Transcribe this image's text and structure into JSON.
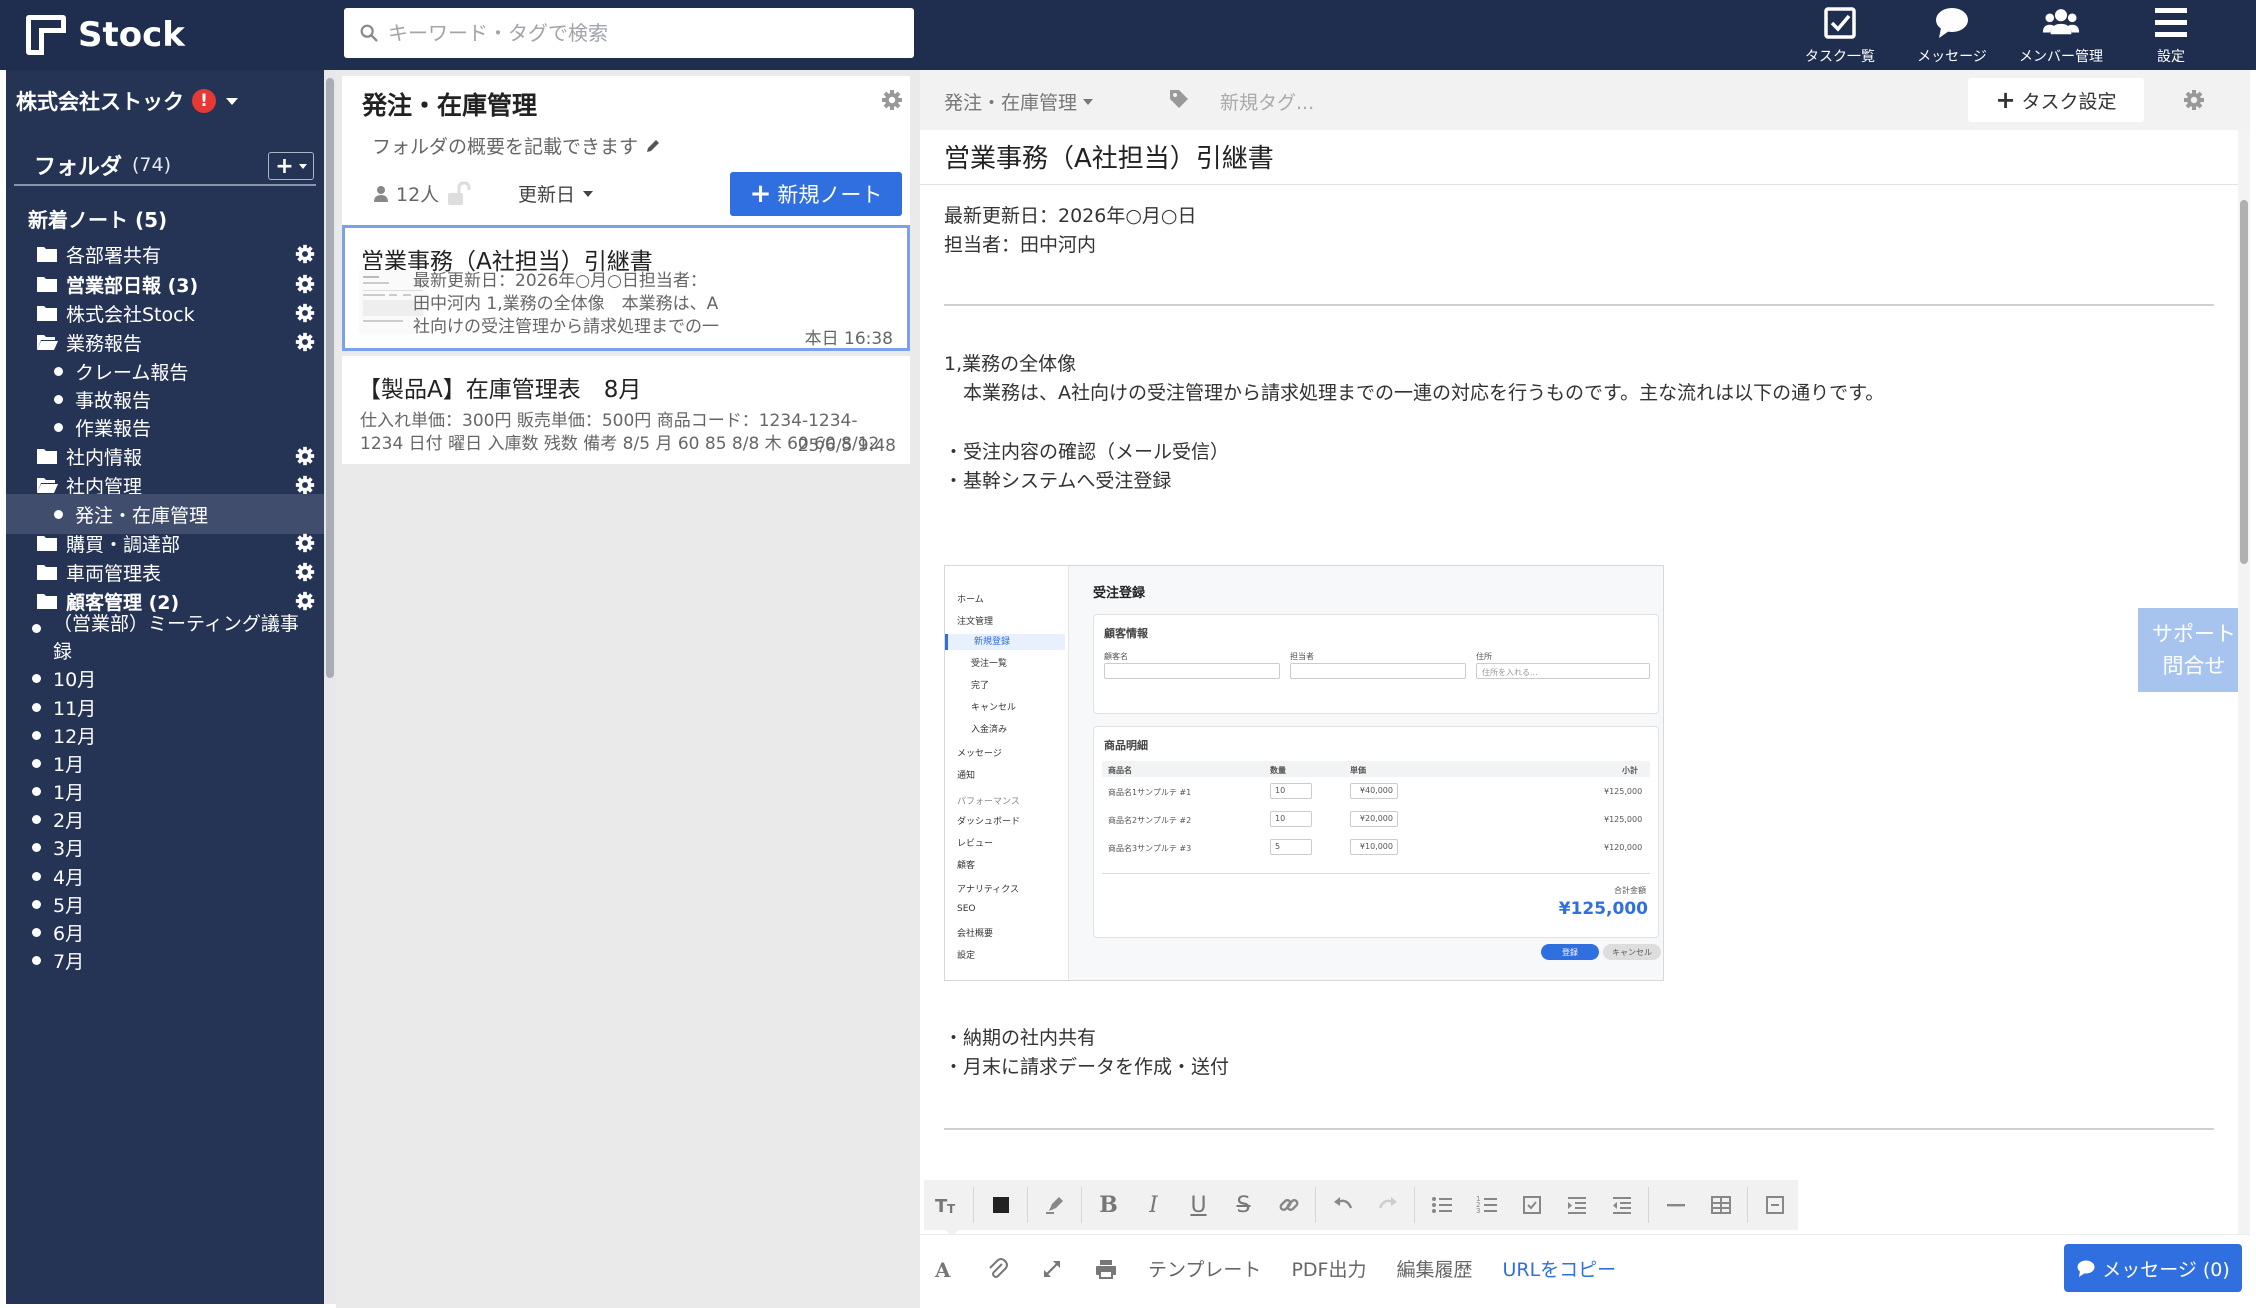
{
  "app": {
    "name": "Stock"
  },
  "search": {
    "placeholder": "キーワード・タグで検索"
  },
  "nav": [
    {
      "label": "タスク一覧",
      "icon": "task-checkbox-icon"
    },
    {
      "label": "メッセージ",
      "icon": "message-bubble-icon"
    },
    {
      "label": "メンバー管理",
      "icon": "members-icon"
    },
    {
      "label": "設定",
      "icon": "menu-icon"
    }
  ],
  "sidebar": {
    "company": "株式会社ストック",
    "alert": "!",
    "folders_label": "フォルダ",
    "folders_count": "(74)",
    "add_label": "+",
    "new_notes": "新着ノート (5)",
    "items": [
      {
        "label": "各部署共有",
        "kind": "folder",
        "bold": false,
        "gear": true
      },
      {
        "label": "営業部日報 (3)",
        "kind": "folder",
        "bold": true,
        "gear": true
      },
      {
        "label": "株式会社Stock",
        "kind": "folder",
        "bold": false,
        "gear": true
      },
      {
        "label": "業務報告",
        "kind": "folder-open",
        "bold": false,
        "gear": true
      },
      {
        "label": "クレーム報告",
        "kind": "sub"
      },
      {
        "label": "事故報告",
        "kind": "sub"
      },
      {
        "label": "作業報告",
        "kind": "sub"
      },
      {
        "label": "社内情報",
        "kind": "folder",
        "bold": false,
        "gear": true
      },
      {
        "label": "社内管理",
        "kind": "folder-open",
        "bold": false,
        "gear": true
      },
      {
        "label": "発注・在庫管理",
        "kind": "sub",
        "active": true
      },
      {
        "label": "購買・調達部",
        "kind": "folder",
        "bold": false,
        "gear": true
      },
      {
        "label": "車両管理表",
        "kind": "folder",
        "bold": false,
        "gear": true
      },
      {
        "label": "顧客管理 (2)",
        "kind": "folder",
        "bold": true,
        "gear": true
      },
      {
        "label": "（営業部）ミーティング議事録",
        "kind": "sub2"
      },
      {
        "label": "10月",
        "kind": "sub2"
      },
      {
        "label": "11月",
        "kind": "sub2"
      },
      {
        "label": "12月",
        "kind": "sub2"
      },
      {
        "label": "1月",
        "kind": "sub2"
      },
      {
        "label": "1月",
        "kind": "sub2"
      },
      {
        "label": "2月",
        "kind": "sub2"
      },
      {
        "label": "3月",
        "kind": "sub2"
      },
      {
        "label": "4月",
        "kind": "sub2"
      },
      {
        "label": "5月",
        "kind": "sub2"
      },
      {
        "label": "6月",
        "kind": "sub2"
      },
      {
        "label": "7月",
        "kind": "sub2"
      }
    ]
  },
  "list": {
    "title": "発注・在庫管理",
    "description": "フォルダの概要を記載できます",
    "members": "12人",
    "sort": "更新日",
    "new_note": "新規ノート",
    "notes": [
      {
        "title": "営業事務（A社担当）引継書",
        "snippet": "最新更新日：2026年○月○日担当者：田中河内 1,業務の全体像　本業務は、A社向けの受注管理から請求処理までの一連の対応を行うものです。主な流れは以下",
        "date": "本日 16:38"
      },
      {
        "title": "【製品A】在庫管理表　8月",
        "snippet": "仕入れ単価：300円 販売単価：500円 商品コード：1234-1234-1234 日付 曜日 入庫数 残数 備考 8/5 月 60 85 8/8 木 60 60 8/12",
        "date": "25/6/5 9:48"
      }
    ]
  },
  "editor": {
    "breadcrumb": "発注・在庫管理",
    "tag_placeholder": "新規タグ...",
    "task_settings": "タスク設定",
    "title": "営業事務（A社担当）引継書",
    "meta_date": "最新更新日：2026年○月○日",
    "meta_person": "担当者：田中河内",
    "section1": "1,業務の全体像",
    "section1_body": "　本業務は、A社向けの受注管理から請求処理までの一連の対応を行うものです。主な流れは以下の通りです。",
    "bullet1": "・受注内容の確認（メール受信）",
    "bullet2": "・基幹システムへ受注登録",
    "bullet3": "・納期の社内共有",
    "bullet4": "・月末に請求データを作成・送付",
    "support": [
      "サポート",
      "問合せ"
    ],
    "bottom_links": [
      "テンプレート",
      "PDF出力",
      "編集履歴",
      "URLをコピー"
    ],
    "message_btn": "メッセージ (0)"
  },
  "embedded_screenshot": {
    "title": "受注登録",
    "nav": [
      "ホーム",
      "注文管理",
      "新規登録",
      "受注一覧",
      "完了",
      "キャンセル",
      "入金済み",
      "メッセージ",
      "通知",
      "パフォーマンス",
      "ダッシュボード",
      "レビュー",
      "顧客",
      "アナリティクス",
      "SEO",
      "会社概要",
      "設定"
    ],
    "customer_section": "顧客情報",
    "customer_fields": [
      "顧客名",
      "担当者",
      "住所"
    ],
    "address_placeholder": "住所を入れる...",
    "items_section": "商品明細",
    "columns": [
      "商品名",
      "数量",
      "単価",
      "小計"
    ],
    "rows": [
      {
        "name": "商品名1サンプルテ #1",
        "qty": "10",
        "price": "¥40,000",
        "subtotal": "¥125,000"
      },
      {
        "name": "商品名2サンプルテ #2",
        "qty": "10",
        "price": "¥20,000",
        "subtotal": "¥125,000"
      },
      {
        "name": "商品名3サンプルテ #3",
        "qty": "5",
        "price": "¥10,000",
        "subtotal": "¥120,000"
      }
    ],
    "total_label": "合計金額",
    "total": "¥125,000",
    "register": "登録",
    "cancel": "キャンセル"
  },
  "colors": {
    "topbar": "#1f2d4e",
    "sidebar": "#253354",
    "accent": "#2f6fe0",
    "alert": "#e53935"
  }
}
